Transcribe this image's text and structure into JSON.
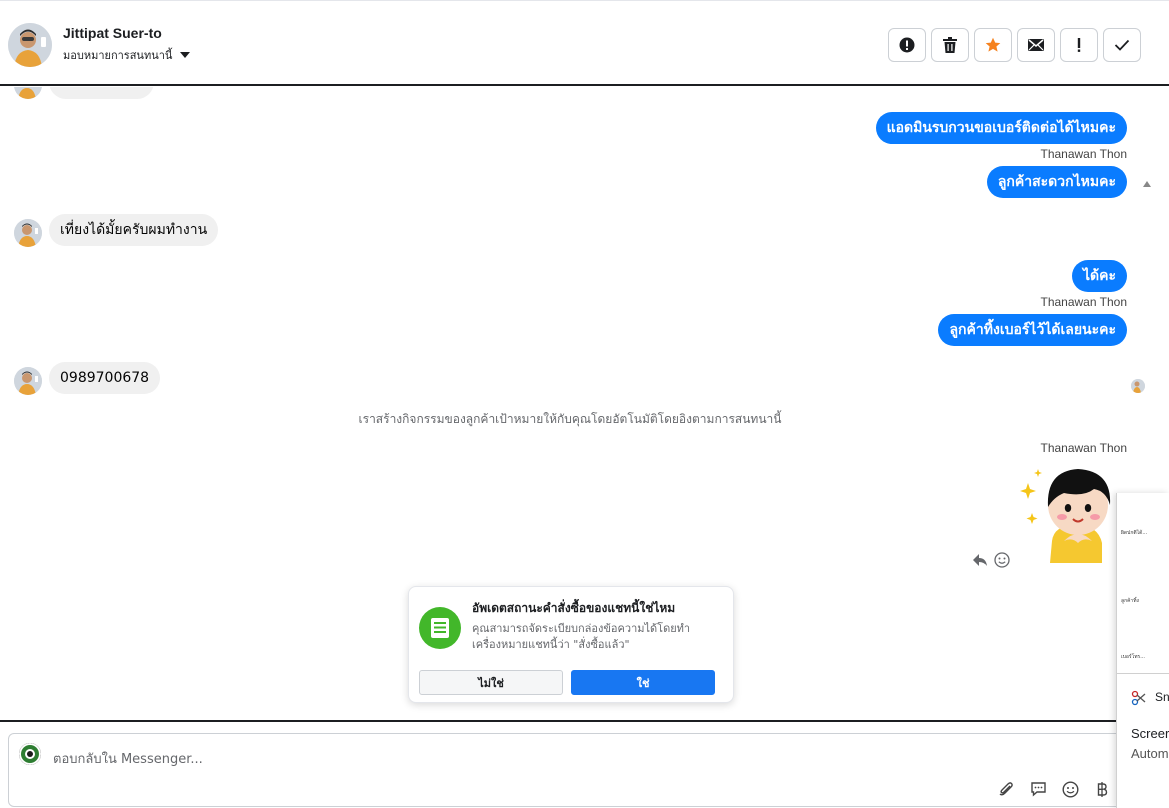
{
  "header": {
    "contact_name": "Jittipat Suer-to",
    "assign_label": "มอบหมายการสนทนานี้",
    "actions": [
      {
        "name": "report-icon",
        "label": "Mark as spam"
      },
      {
        "name": "trash-icon",
        "label": "Delete"
      },
      {
        "name": "star-icon",
        "label": "Follow up",
        "color": "#f5821f"
      },
      {
        "name": "mail-icon",
        "label": "Mark as unread"
      },
      {
        "name": "exclamation-icon",
        "label": "Important"
      },
      {
        "name": "check-icon",
        "label": "Done"
      }
    ]
  },
  "messages": {
    "m1": "แอดมินรบกวนขอเบอร์ติดต่อได้ไหมคะ",
    "m1_sender": "Thanawan Thon",
    "m2": "ลูกค้าสะดวกไหมคะ",
    "m3": "เที่ยงได้มั้ยครับผมทำงาน",
    "m4": "ได้คะ",
    "m4_sender": "Thanawan Thon",
    "m5": "ลูกค้าทิ้งเบอร์ไว้ได้เลยนะคะ",
    "m6": "0989700678",
    "system_note": "เราสร้างกิจกรรมของลูกค้าเป้าหมายให้กับคุณโดยอัตโนมัติโดยอิงตามการสนทนานี้",
    "sticker_sender": "Thanawan Thon"
  },
  "popup": {
    "title": "อัพเดตสถานะคำสั่งซื้อของแชทนี้ใช่ไหม",
    "description": "คุณสามารถจัดระเบียบกล่องข้อความได้โดยทำเครื่องหมายแชทนี้ว่า \"สั่งซื้อแล้ว\"",
    "no_label": "ไม่ใช่",
    "yes_label": "ใช่"
  },
  "composer": {
    "placeholder": "ตอบกลับใน Messenger..."
  },
  "snip_panel": {
    "app_name": "Sn",
    "title": "Screer",
    "subtitle": "Autom",
    "mini_1": "ผิดปกติได้...",
    "mini_2": "ลูกค้าทิ้ง",
    "mini_3": "เบอร์โทร..."
  },
  "colors": {
    "outgoing_bubble": "#0a7cff",
    "incoming_bubble": "#f0f0f0",
    "popup_yes": "#1877f2",
    "popup_icon": "#42b72a"
  }
}
